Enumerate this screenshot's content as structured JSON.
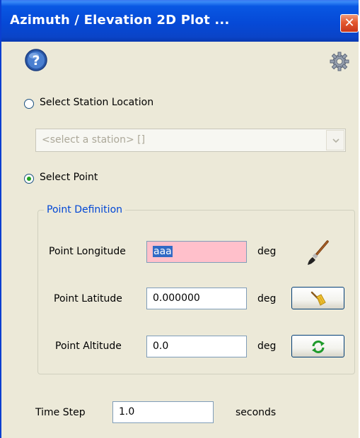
{
  "window": {
    "title": "Azimuth / Elevation 2D Plot ..."
  },
  "icons": {
    "help": "help-icon",
    "settings": "gear-icon",
    "close": "close-icon",
    "paint": "paintbrush-icon",
    "clear": "broom-icon",
    "refresh": "refresh-icon"
  },
  "station_option": {
    "label": "Select Station Location",
    "selected": false,
    "dropdown_value": "<select a station> []",
    "dropdown_enabled": false
  },
  "point_option": {
    "label": "Select Point",
    "selected": true
  },
  "point_definition": {
    "group_title": "Point Definition",
    "longitude": {
      "label": "Point Longitude",
      "value": "aaa",
      "unit": "deg",
      "invalid": true
    },
    "latitude": {
      "label": "Point Latitude",
      "value": "0.000000",
      "unit": "deg"
    },
    "altitude": {
      "label": "Point Altitude",
      "value": "0.0",
      "unit": "deg"
    }
  },
  "time_step": {
    "label": "Time Step",
    "value": "1.0",
    "unit": "seconds"
  },
  "colors": {
    "titlebar": "#0a52e0",
    "window_bg": "#ece9d8",
    "invalid_field": "#ffc0cb",
    "group_title": "#0046d5",
    "selection": "#316ac5"
  }
}
